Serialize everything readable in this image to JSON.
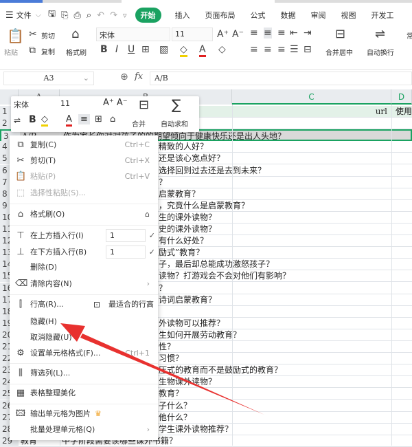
{
  "menubar": {
    "file": "文件",
    "tabs": [
      "开始",
      "插入",
      "页面布局",
      "公式",
      "数据",
      "审阅",
      "视图",
      "开发工"
    ]
  },
  "ribbon": {
    "paste": "粘贴",
    "cut": "剪切",
    "copy": "复制",
    "format_painter": "格式刷",
    "font": "宋体",
    "size": "11",
    "merge": "合并居中",
    "wrap": "自动换行",
    "normal": "常"
  },
  "formula_bar": {
    "cell_ref": "A3",
    "fx": "fx",
    "value": "A/B"
  },
  "columns": [
    "A",
    "B",
    "C",
    "D"
  ],
  "rows": [
    {
      "n": "1",
      "a": "",
      "b": "",
      "c": "url",
      "d": "使用"
    },
    {
      "n": "2",
      "b": "？"
    },
    {
      "n": "3",
      "a": "A/B",
      "b": "作为家长你对对孩子的的期望倾向于健康快乐还是出人头地？"
    },
    {
      "n": "4",
      "b": "精致的人好？"
    },
    {
      "n": "5",
      "b": "还是该心宽点好？"
    },
    {
      "n": "6",
      "b": "选择回到过去还是去到未来？"
    },
    {
      "n": "7",
      "b": "？"
    },
    {
      "n": "8",
      "b": "启蒙教育？"
    },
    {
      "n": "9",
      "b": "，究竟什么是启蒙教育？"
    },
    {
      "n": "10",
      "b": "生的课外读物？"
    },
    {
      "n": "11",
      "b": "史的课外读物？"
    },
    {
      "n": "12",
      "b": "有什么好处？"
    },
    {
      "n": "13",
      "b": "励式”教育？"
    },
    {
      "n": "14",
      "b": "子，最后却总能成功激怒孩子？"
    },
    {
      "n": "15",
      "b": "读物？打游戏会不会对他们有影响？"
    },
    {
      "n": "16",
      "b": "？"
    },
    {
      "n": "17",
      "b": "诗词启蒙教育？"
    },
    {
      "n": "18",
      "b": ""
    },
    {
      "n": "19",
      "b": "外读物可以推荐？"
    },
    {
      "n": "20",
      "b": "生如何开展劳动教育？"
    },
    {
      "n": "21",
      "b": "性？"
    },
    {
      "n": "22",
      "b": "习惯？"
    },
    {
      "n": "23",
      "b": "压式的教育而不是鼓励式的教育？"
    },
    {
      "n": "24",
      "b": "生物课外读物？"
    },
    {
      "n": "25",
      "b": "教育？"
    },
    {
      "n": "26",
      "b": "子什么？"
    },
    {
      "n": "27",
      "b": "他什么？"
    },
    {
      "n": "28",
      "b": "学生课外读物推荐？"
    },
    {
      "n": "29",
      "a": "教育",
      "b": "中学阶段需要读哪些课外书籍？"
    }
  ],
  "mini_toolbar": {
    "font": "宋体",
    "size": "11",
    "merge": "合并",
    "autosum": "自动求和"
  },
  "context_menu": {
    "copy": "复制(C)",
    "copy_key": "Ctrl+C",
    "cut": "剪切(T)",
    "cut_key": "Ctrl+X",
    "paste": "粘贴(P)",
    "paste_key": "Ctrl+V",
    "paste_special": "选择性粘贴(S)...",
    "format_painter": "格式刷(O)",
    "insert_above": "在上方插入行(I)",
    "insert_above_count": "1",
    "insert_below": "在下方插入行(B)",
    "insert_below_count": "1",
    "delete": "删除(D)",
    "clear": "清除内容(N)",
    "row_height": "行高(R)...",
    "best_fit": "最适合的行高",
    "hide": "隐藏(H)",
    "unhide": "取消隐藏(U)",
    "format_cells": "设置单元格格式(F)...",
    "format_cells_key": "Ctrl+1",
    "filter_col": "筛选列(L)...",
    "beautify": "表格整理美化",
    "export_image": "输出单元格为图片",
    "batch": "批量处理单元格(Q)"
  },
  "colors": {
    "accent": "#1aa261",
    "arrow": "#e8312f"
  }
}
